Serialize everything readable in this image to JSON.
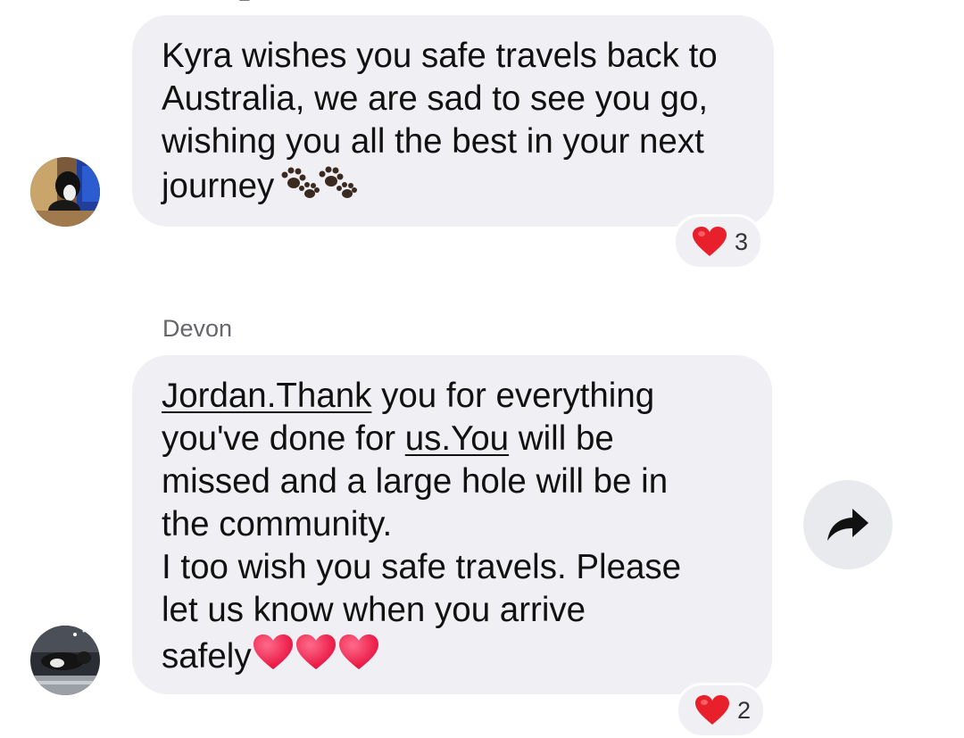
{
  "messages": [
    {
      "text_parts": [
        "Kyra wishes you safe travels back to\nAustralia, we are sad to see you go,\nwishing you all the best in your next\njourney"
      ],
      "reaction": {
        "emoji": "heart",
        "count": "3"
      }
    },
    {
      "sender": "Devon",
      "text_parts": [
        "Jordan.Thank",
        " you for everything\nyou've done for ",
        "us.You",
        " will be\nmissed and a large hole will be in\nthe community.\nI too wish you safe travels. Please\nlet us know when you arrive\nsafely"
      ],
      "reaction": {
        "emoji": "heart",
        "count": "2"
      }
    }
  ],
  "icons": {
    "trailing_emoji_1": "paw-prints",
    "trailing_emoji_2": "red-hearts",
    "share": "share-arrow-icon"
  },
  "colors": {
    "bubble": "#f0f0f4",
    "heart": "#e8202b",
    "secondary_text": "#65676b"
  }
}
